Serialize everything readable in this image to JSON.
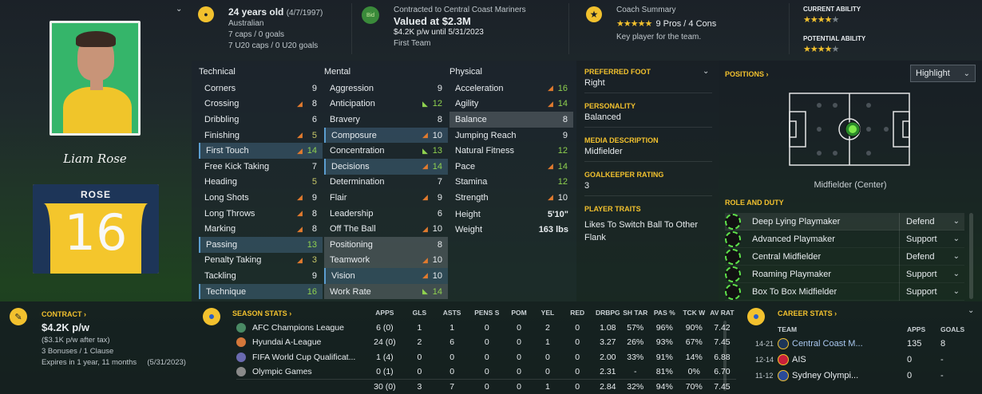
{
  "header": {
    "age": "24 years old",
    "dob": "(4/7/1997)",
    "nationality": "Australian",
    "caps": "7 caps / 0 goals",
    "u20caps": "7 U20 caps / 0 U20 goals",
    "contract_club": "Contracted to Central Coast Mariners",
    "value": "Valued at $2.3M",
    "wage_line": "$4.2K p/w until 5/31/2023",
    "squad": "First Team",
    "bid_label": "Bid",
    "coach_title": "Coach Summary",
    "coach_pros": "9 Pros / 4 Cons",
    "coach_desc": "Key player for the team.",
    "coach_stars": [
      1,
      1,
      1,
      1,
      0.5
    ],
    "current_ability": "CURRENT ABILITY",
    "current_stars": [
      1,
      1,
      1,
      1,
      0
    ],
    "potential_ability": "POTENTIAL ABILITY",
    "potential_stars": [
      1,
      1,
      1,
      1,
      0
    ]
  },
  "player": {
    "signature": "Liam Rose",
    "shirt_name": "ROSE",
    "shirt_number": "16"
  },
  "attributes": {
    "technical_title": "Technical",
    "mental_title": "Mental",
    "physical_title": "Physical",
    "technical": [
      {
        "n": "Corners",
        "v": "9",
        "t": "",
        "c": ""
      },
      {
        "n": "Crossing",
        "v": "8",
        "t": "dn",
        "c": ""
      },
      {
        "n": "Dribbling",
        "v": "6",
        "t": "",
        "c": ""
      },
      {
        "n": "Finishing",
        "v": "5",
        "t": "dn",
        "c": "yel"
      },
      {
        "n": "First Touch",
        "v": "14",
        "t": "dn",
        "c": "green",
        "h": "hl"
      },
      {
        "n": "Free Kick Taking",
        "v": "7",
        "t": "",
        "c": ""
      },
      {
        "n": "Heading",
        "v": "5",
        "t": "",
        "c": "yel"
      },
      {
        "n": "Long Shots",
        "v": "9",
        "t": "dn",
        "c": ""
      },
      {
        "n": "Long Throws",
        "v": "8",
        "t": "dn",
        "c": ""
      },
      {
        "n": "Marking",
        "v": "8",
        "t": "dn",
        "c": ""
      },
      {
        "n": "Passing",
        "v": "13",
        "t": "",
        "c": "green",
        "h": "hl"
      },
      {
        "n": "Penalty Taking",
        "v": "3",
        "t": "dn",
        "c": "yel"
      },
      {
        "n": "Tackling",
        "v": "9",
        "t": "",
        "c": ""
      },
      {
        "n": "Technique",
        "v": "16",
        "t": "",
        "c": "green",
        "h": "hl"
      }
    ],
    "mental": [
      {
        "n": "Aggression",
        "v": "9",
        "t": "",
        "c": ""
      },
      {
        "n": "Anticipation",
        "v": "12",
        "t": "up",
        "c": "green"
      },
      {
        "n": "Bravery",
        "v": "8",
        "t": "",
        "c": ""
      },
      {
        "n": "Composure",
        "v": "10",
        "t": "dn",
        "c": "",
        "h": "hl"
      },
      {
        "n": "Concentration",
        "v": "13",
        "t": "up",
        "c": "green"
      },
      {
        "n": "Decisions",
        "v": "14",
        "t": "dn",
        "c": "green",
        "h": "hl"
      },
      {
        "n": "Determination",
        "v": "7",
        "t": "",
        "c": ""
      },
      {
        "n": "Flair",
        "v": "9",
        "t": "dn",
        "c": ""
      },
      {
        "n": "Leadership",
        "v": "6",
        "t": "",
        "c": ""
      },
      {
        "n": "Off The Ball",
        "v": "10",
        "t": "dn",
        "c": ""
      },
      {
        "n": "Positioning",
        "v": "8",
        "t": "",
        "c": "",
        "h": "hl2"
      },
      {
        "n": "Teamwork",
        "v": "10",
        "t": "dn",
        "c": "",
        "h": "hl2"
      },
      {
        "n": "Vision",
        "v": "10",
        "t": "dn",
        "c": "",
        "h": "hl"
      },
      {
        "n": "Work Rate",
        "v": "14",
        "t": "up",
        "c": "green",
        "h": "hl2"
      }
    ],
    "physical": [
      {
        "n": "Acceleration",
        "v": "16",
        "t": "dn",
        "c": "green"
      },
      {
        "n": "Agility",
        "v": "14",
        "t": "dn",
        "c": "green"
      },
      {
        "n": "Balance",
        "v": "8",
        "t": "",
        "c": "",
        "h": "hl2"
      },
      {
        "n": "Jumping Reach",
        "v": "9",
        "t": "",
        "c": ""
      },
      {
        "n": "Natural Fitness",
        "v": "12",
        "t": "",
        "c": "green"
      },
      {
        "n": "Pace",
        "v": "14",
        "t": "dn",
        "c": "green"
      },
      {
        "n": "Stamina",
        "v": "12",
        "t": "",
        "c": "green"
      },
      {
        "n": "Strength",
        "v": "10",
        "t": "dn",
        "c": ""
      }
    ],
    "height_label": "Height",
    "height": "5'10\"",
    "weight_label": "Weight",
    "weight": "163 lbs"
  },
  "info": {
    "foot_label": "PREFERRED FOOT",
    "foot": "Right",
    "personality_label": "PERSONALITY",
    "personality": "Balanced",
    "media_label": "MEDIA DESCRIPTION",
    "media": "Midfielder",
    "gk_label": "GOALKEEPER RATING",
    "gk": "3",
    "traits_label": "PLAYER TRAITS",
    "traits": "Likes To Switch Ball To Other Flank"
  },
  "positions": {
    "title": "POSITIONS",
    "view": "Highlight",
    "position_name": "Midfielder (Center)"
  },
  "roles": {
    "title": "ROLE AND DUTY",
    "items": [
      {
        "role": "Deep Lying Playmaker",
        "duty": "Defend"
      },
      {
        "role": "Advanced Playmaker",
        "duty": "Support"
      },
      {
        "role": "Central Midfielder",
        "duty": "Defend"
      },
      {
        "role": "Roaming Playmaker",
        "duty": "Support"
      },
      {
        "role": "Box To Box Midfielder",
        "duty": "Support"
      }
    ]
  },
  "contract": {
    "title": "CONTRACT",
    "wage": "$4.2K p/w",
    "after_tax": "($3.1K p/w after tax)",
    "bonuses": "3 Bonuses / 1 Clause",
    "expires": "Expires in 1 year, 11 months",
    "expiry_date": "(5/31/2023)"
  },
  "season": {
    "title": "SEASON STATS",
    "cols": [
      "APPS",
      "GLS",
      "ASTS",
      "PENS S",
      "POM",
      "YEL",
      "RED",
      "DRBPG",
      "SH TAR",
      "PAS %",
      "TCK W",
      "AV RAT"
    ],
    "rows": [
      {
        "comp": "AFC Champions League",
        "vals": [
          "6 (0)",
          "1",
          "1",
          "0",
          "0",
          "2",
          "0",
          "1.08",
          "57%",
          "96%",
          "90%",
          "7.42"
        ]
      },
      {
        "comp": "Hyundai A-League",
        "vals": [
          "24 (0)",
          "2",
          "6",
          "0",
          "0",
          "1",
          "0",
          "3.27",
          "26%",
          "93%",
          "67%",
          "7.45"
        ]
      },
      {
        "comp": "FIFA World Cup Qualificat...",
        "vals": [
          "1 (4)",
          "0",
          "0",
          "0",
          "0",
          "0",
          "0",
          "2.00",
          "33%",
          "91%",
          "14%",
          "6.88"
        ]
      },
      {
        "comp": "Olympic Games",
        "vals": [
          "0 (1)",
          "0",
          "0",
          "0",
          "0",
          "0",
          "0",
          "2.31",
          "-",
          "81%",
          "0%",
          "6.70"
        ]
      },
      {
        "comp": "",
        "vals": [
          "30 (0)",
          "3",
          "7",
          "0",
          "0",
          "1",
          "0",
          "2.84",
          "32%",
          "94%",
          "70%",
          "7.45"
        ]
      }
    ]
  },
  "career": {
    "title": "CAREER STATS",
    "col_team": "TEAM",
    "col_apps": "APPS",
    "col_goals": "GOALS",
    "rows": [
      {
        "years": "14-21",
        "team": "Central Coast M...",
        "apps": "135",
        "goals": "8"
      },
      {
        "years": "12-14",
        "team": "AIS",
        "apps": "0",
        "goals": "-"
      },
      {
        "years": "11-12",
        "team": "Sydney Olympi...",
        "apps": "0",
        "goals": "-"
      }
    ]
  },
  "colors": {
    "accent": "#f2c12e",
    "highlight": "#5c9ed0",
    "good": "#8fd14f",
    "bad": "#e07a2e"
  }
}
